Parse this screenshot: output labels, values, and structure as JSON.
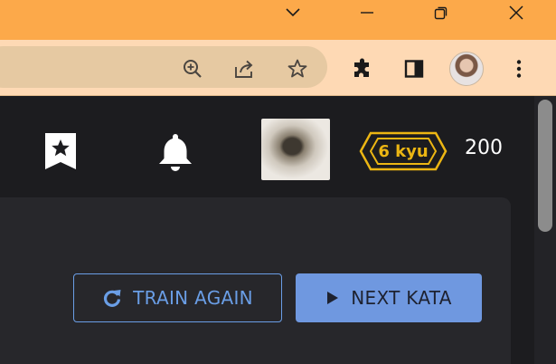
{
  "window": {
    "minimize_icon": "minimize-icon",
    "restore_icon": "restore-icon",
    "close_icon": "close-icon",
    "tabstrip_chevron_icon": "chevron-down-icon"
  },
  "toolbar": {
    "icons": [
      "zoom-icon",
      "share-icon",
      "star-icon",
      "extensions-icon",
      "side-panel-icon",
      "profile-avatar",
      "menu-icon"
    ]
  },
  "nav": {
    "bookmark_icon": "bookmark-star-icon",
    "notifications_icon": "bell-icon",
    "rank": "6 kyu",
    "honor": "200"
  },
  "actions": {
    "train_again": "TRAIN AGAIN",
    "next_kata": "NEXT KATA"
  },
  "colors": {
    "titlebar": "#fca94a",
    "toolbar": "#fed9b4",
    "page_bg": "#1c1c1f",
    "panel_bg": "#27272b",
    "rank": "#ecb613",
    "accent_blue": "#6a9ee6"
  }
}
